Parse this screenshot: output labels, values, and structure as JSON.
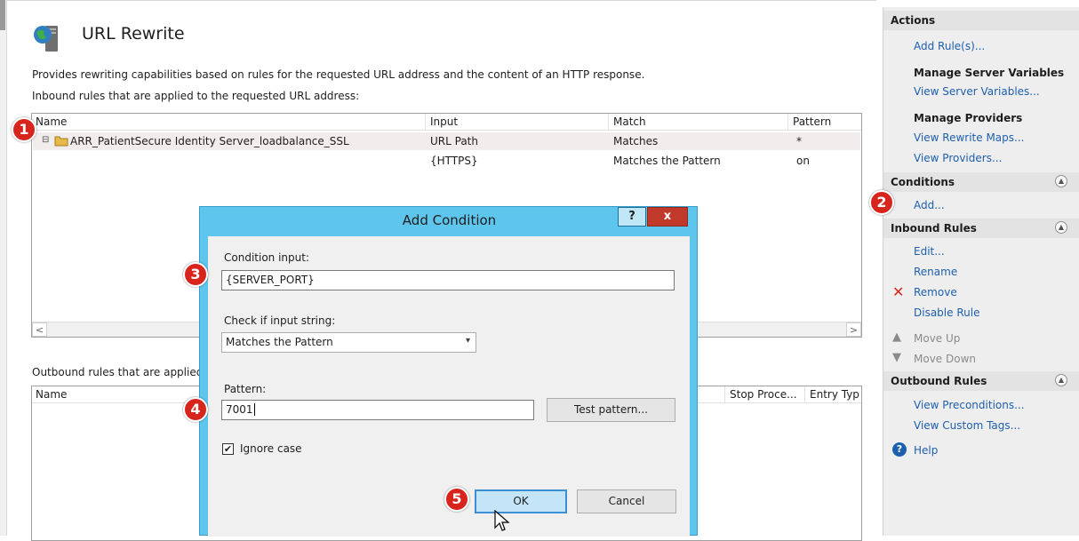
{
  "page": {
    "title": "URL Rewrite",
    "description": "Provides rewriting capabilities based on rules for the requested URL address and the content of an HTTP response.",
    "inbound_caption": "Inbound rules that are applied to the requested URL address:",
    "outbound_caption": "Outbound rules that are applied"
  },
  "inbound_table": {
    "headers": [
      "Name",
      "Input",
      "Match",
      "Pattern"
    ],
    "rows": [
      {
        "name": "ARR_PatientSecure Identity Server_loadbalance_SSL",
        "input": "URL Path",
        "match": "Matches",
        "pattern": "*"
      },
      {
        "name": "",
        "input": "{HTTPS}",
        "match": "Matches the Pattern",
        "pattern": "on"
      }
    ]
  },
  "outbound_table": {
    "headers": [
      "Name",
      "Stop Proce...",
      "Entry Typ"
    ]
  },
  "actions": {
    "title": "Actions",
    "add_rules": "Add Rule(s)...",
    "manage_server_variables": "Manage Server Variables",
    "view_server_variables": "View Server Variables...",
    "manage_providers": "Manage Providers",
    "view_rewrite_maps": "View Rewrite Maps...",
    "view_providers": "View Providers...",
    "conditions_title": "Conditions",
    "conditions_add": "Add...",
    "inbound_rules_title": "Inbound Rules",
    "edit": "Edit...",
    "rename": "Rename",
    "remove": "Remove",
    "disable_rule": "Disable Rule",
    "move_up": "Move Up",
    "move_down": "Move Down",
    "outbound_rules_title": "Outbound Rules",
    "view_preconditions": "View Preconditions...",
    "view_custom_tags": "View Custom Tags...",
    "help": "Help"
  },
  "dialog": {
    "title": "Add Condition",
    "help_label": "?",
    "close_label": "x",
    "condition_input_label": "Condition input:",
    "condition_input_value": "{SERVER_PORT}",
    "check_label": "Check if input string:",
    "check_value": "Matches the Pattern",
    "pattern_label": "Pattern:",
    "pattern_value": "7001",
    "test_pattern": "Test pattern...",
    "ignore_case": "Ignore case",
    "ignore_case_checked": true,
    "ok": "OK",
    "cancel": "Cancel"
  },
  "callouts": [
    "1",
    "2",
    "3",
    "4",
    "5"
  ],
  "colors": {
    "dialog_frame": "#5ec5ed",
    "callout": "#d7241c",
    "link": "#1e5fad",
    "close_button": "#c0392b"
  }
}
